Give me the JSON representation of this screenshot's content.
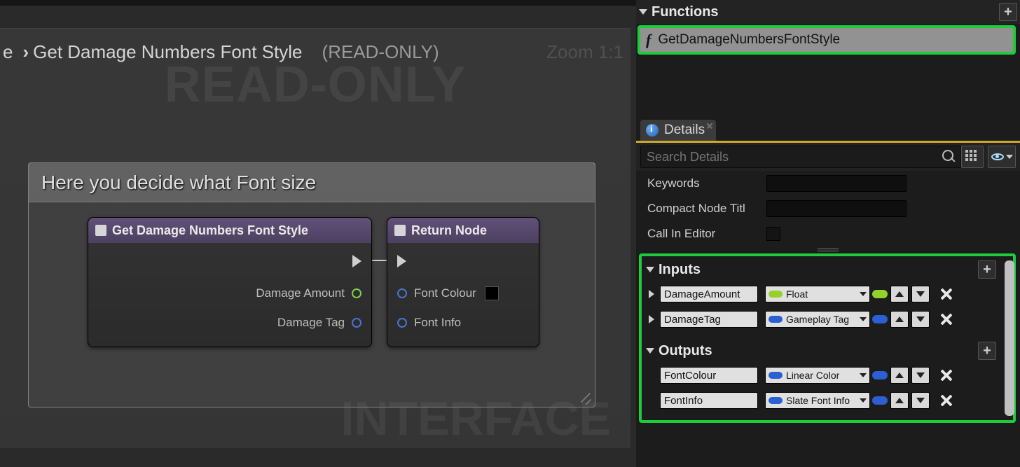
{
  "graph": {
    "breadcrumb_prefix": "e",
    "breadcrumb_current": "Get Damage Numbers Font Style",
    "readonly_tag": "(READ-ONLY)",
    "zoom_label": "Zoom 1:1",
    "watermark_readonly": "READ-ONLY",
    "watermark_interface": "INTERFACE",
    "comment_title": "Here you decide what Font size",
    "node_func": {
      "title": "Get Damage Numbers Font Style",
      "pin_damage_amount": "Damage Amount",
      "pin_damage_tag": "Damage Tag"
    },
    "node_return": {
      "title": "Return Node",
      "pin_font_colour": "Font Colour",
      "pin_font_info": "Font Info"
    }
  },
  "functions": {
    "header": "Functions",
    "item": "GetDamageNumbersFontStyle"
  },
  "details": {
    "tab_label": "Details",
    "search_placeholder": "Search Details",
    "keywords_label": "Keywords",
    "compact_label": "Compact Node Titl",
    "callin_label": "Call In Editor"
  },
  "inputs": {
    "header": "Inputs",
    "rows": [
      {
        "name": "DamageAmount",
        "type": "Float",
        "pill": "green"
      },
      {
        "name": "DamageTag",
        "type": "Gameplay Tag",
        "pill": "blue"
      }
    ]
  },
  "outputs": {
    "header": "Outputs",
    "rows": [
      {
        "name": "FontColour",
        "type": "Linear Color",
        "pill": "blue"
      },
      {
        "name": "FontInfo",
        "type": "Slate Font Info",
        "pill": "blue"
      }
    ]
  }
}
